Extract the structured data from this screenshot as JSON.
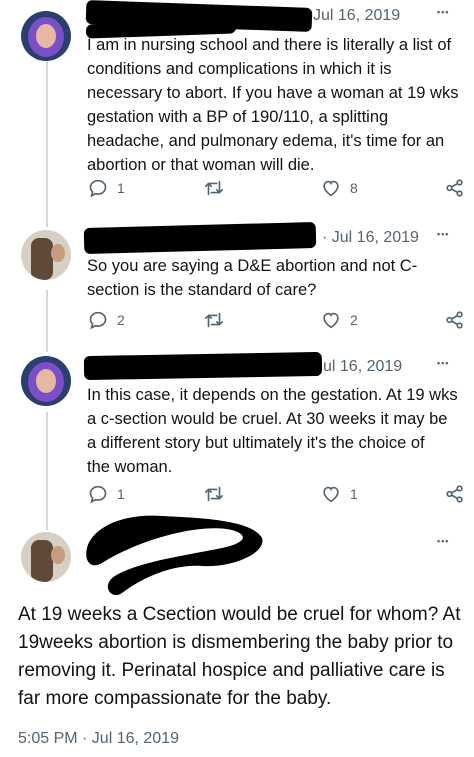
{
  "tweets": [
    {
      "date": "Jul 16, 2019",
      "more": "•••",
      "lines": [
        "I am in nursing school and there is literally a list of",
        "conditions and complications in which it is",
        "necessary to abort. If you have a woman at 19 wks",
        "gestation with a BP of 190/110, a splitting",
        "headache, and pulmonary edema, it's time for an",
        "abortion or that woman will die."
      ],
      "reply_count": "1",
      "like_count": "8"
    },
    {
      "date": "· Jul 16, 2019",
      "more": "•••",
      "lines": [
        "So you are saying a D&E abortion and not C-",
        "section is the standard of care?"
      ],
      "reply_count": "2",
      "like_count": "2"
    },
    {
      "date": "ul 16, 2019",
      "more": "•••",
      "lines": [
        "In this case, it depends on the gestation. At 19 wks",
        "a c-section would be cruel. At 30 weeks it may be",
        "a different story but ultimately it's the choice of",
        "the woman."
      ],
      "reply_count": "1",
      "like_count": "1"
    }
  ],
  "main_tweet": {
    "more": "•••",
    "lines": [
      "At 19 weeks a Csection would be cruel for whom? At",
      "19weeks abortion is dismembering the baby prior to",
      "removing it. Perinatal hospice and palliative care is",
      "far more compassionate for the baby."
    ],
    "timestamp": "5:05 PM · Jul 16, 2019"
  },
  "icons": [
    "reply-icon",
    "retweet-icon",
    "like-icon",
    "share-icon"
  ]
}
